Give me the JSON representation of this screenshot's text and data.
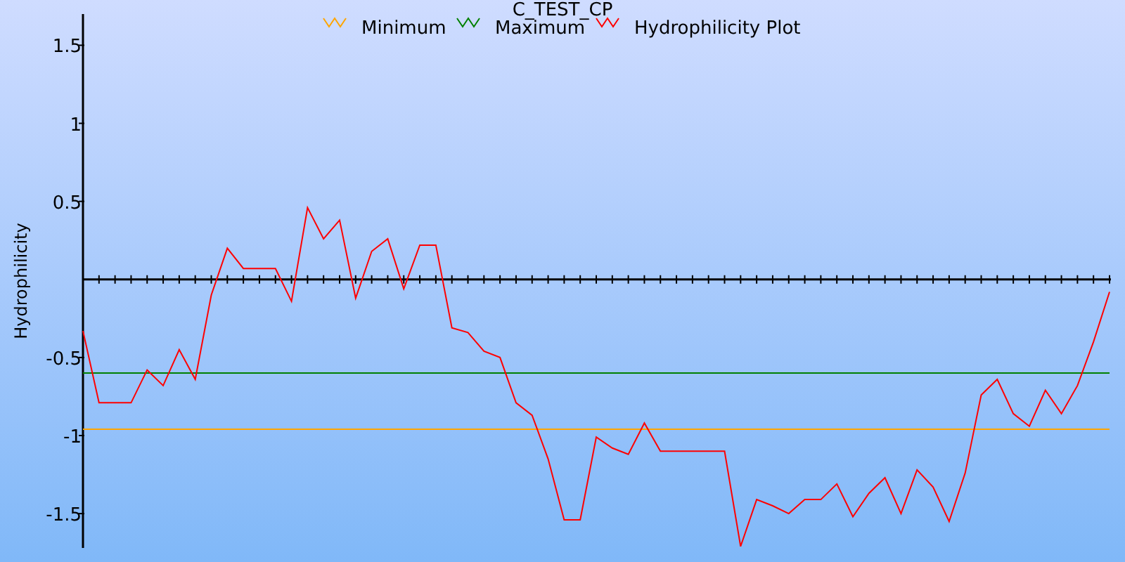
{
  "chart": {
    "chart_data": {
      "type": "line",
      "title": "C_TEST_CP",
      "ylabel": "Hydrophilicity",
      "legend": true,
      "ylim": [
        -1.72,
        1.7
      ],
      "yticks": [
        -1.5,
        -1,
        -0.5,
        0.5,
        1,
        1.5
      ],
      "series": [
        {
          "name": "Minimum",
          "color": "#ffa500",
          "values": [
            -0.96,
            -0.96,
            -0.96,
            -0.96,
            -0.96,
            -0.96,
            -0.96,
            -0.96,
            -0.96,
            -0.96,
            -0.96,
            -0.96,
            -0.96,
            -0.96,
            -0.96,
            -0.96,
            -0.96,
            -0.96,
            -0.96,
            -0.96,
            -0.96,
            -0.96,
            -0.96,
            -0.96,
            -0.96,
            -0.96,
            -0.96,
            -0.96,
            -0.96,
            -0.96,
            -0.96,
            -0.96,
            -0.96,
            -0.96,
            -0.96,
            -0.96,
            -0.96,
            -0.96,
            -0.96,
            -0.96,
            -0.96,
            -0.96,
            -0.96,
            -0.96,
            -0.96,
            -0.96,
            -0.96,
            -0.96,
            -0.96,
            -0.96,
            -0.96,
            -0.96,
            -0.96,
            -0.96,
            -0.96,
            -0.96,
            -0.96,
            -0.96,
            -0.96,
            -0.96,
            -0.96,
            -0.96,
            -0.96,
            -0.96,
            -0.96
          ]
        },
        {
          "name": "Maximum",
          "color": "#008000",
          "values": [
            -0.6,
            -0.6,
            -0.6,
            -0.6,
            -0.6,
            -0.6,
            -0.6,
            -0.6,
            -0.6,
            -0.6,
            -0.6,
            -0.6,
            -0.6,
            -0.6,
            -0.6,
            -0.6,
            -0.6,
            -0.6,
            -0.6,
            -0.6,
            -0.6,
            -0.6,
            -0.6,
            -0.6,
            -0.6,
            -0.6,
            -0.6,
            -0.6,
            -0.6,
            -0.6,
            -0.6,
            -0.6,
            -0.6,
            -0.6,
            -0.6,
            -0.6,
            -0.6,
            -0.6,
            -0.6,
            -0.6,
            -0.6,
            -0.6,
            -0.6,
            -0.6,
            -0.6,
            -0.6,
            -0.6,
            -0.6,
            -0.6,
            -0.6,
            -0.6,
            -0.6,
            -0.6,
            -0.6,
            -0.6,
            -0.6,
            -0.6,
            -0.6,
            -0.6,
            -0.6,
            -0.6,
            -0.6,
            -0.6,
            -0.6,
            -0.6
          ]
        },
        {
          "name": "Hydrophilicity Plot",
          "color": "#ff0000",
          "values": [
            -0.33,
            -0.79,
            -0.79,
            -0.79,
            -0.58,
            -0.68,
            -0.45,
            -0.64,
            -0.1,
            0.2,
            0.07,
            0.07,
            0.07,
            -0.14,
            0.46,
            0.26,
            0.38,
            -0.12,
            0.18,
            0.26,
            -0.06,
            0.22,
            0.22,
            -0.31,
            -0.34,
            -0.46,
            -0.5,
            -0.79,
            -0.87,
            -1.15,
            -1.54,
            -1.54,
            -1.01,
            -1.08,
            -1.12,
            -0.92,
            -1.1,
            -1.1,
            -1.1,
            -1.1,
            -1.1,
            -1.71,
            -1.41,
            -1.45,
            -1.5,
            -1.41,
            -1.41,
            -1.31,
            -1.52,
            -1.37,
            -1.27,
            -1.5,
            -1.22,
            -1.33,
            -1.55,
            -1.24,
            -0.74,
            -0.64,
            -0.86,
            -0.94,
            -0.71,
            -0.86,
            -0.68,
            -0.4,
            -0.08
          ]
        }
      ]
    }
  }
}
